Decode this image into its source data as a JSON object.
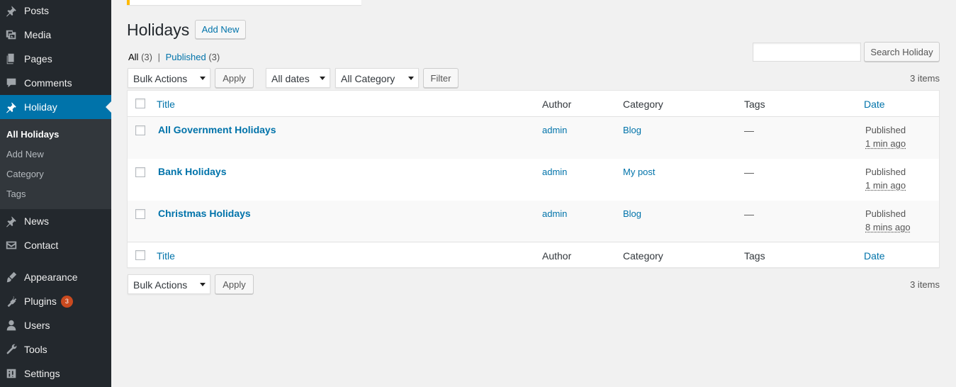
{
  "sidebar": {
    "items": [
      {
        "label": "Posts",
        "icon": "pin-icon"
      },
      {
        "label": "Media",
        "icon": "media-icon"
      },
      {
        "label": "Pages",
        "icon": "pages-icon"
      },
      {
        "label": "Comments",
        "icon": "comment-icon"
      },
      {
        "label": "Holiday",
        "icon": "pin-icon",
        "active": true
      },
      {
        "label": "News",
        "icon": "pin-icon"
      },
      {
        "label": "Contact",
        "icon": "mail-icon"
      },
      {
        "label": "Appearance",
        "icon": "brush-icon"
      },
      {
        "label": "Plugins",
        "icon": "plugin-icon",
        "badge": "3"
      },
      {
        "label": "Users",
        "icon": "user-icon"
      },
      {
        "label": "Tools",
        "icon": "wrench-icon"
      },
      {
        "label": "Settings",
        "icon": "settings-icon"
      }
    ],
    "submenu": [
      "All Holidays",
      "Add New",
      "Category",
      "Tags"
    ],
    "active_color": "#0073aa",
    "background": "#23282d",
    "badge_color": "#ca4a1f"
  },
  "header": {
    "title": "Holidays",
    "add_new": "Add New"
  },
  "views": {
    "all_label": "All",
    "all_count": "(3)",
    "separator": "|",
    "published_label": "Published",
    "published_count": "(3)"
  },
  "search": {
    "placeholder": "",
    "button": "Search Holiday"
  },
  "filters": {
    "bulk_actions": "Bulk Actions",
    "apply": "Apply",
    "dates": "All dates",
    "category": "All Category",
    "filter": "Filter",
    "items_count": "3 items"
  },
  "table": {
    "columns": [
      "Title",
      "Author",
      "Category",
      "Tags",
      "Date"
    ],
    "rows": [
      {
        "title": "All Government Holidays",
        "author": "admin",
        "category": "Blog",
        "tags": "—",
        "status": "Published",
        "ago": "1 min ago"
      },
      {
        "title": "Bank Holidays",
        "author": "admin",
        "category": "My post",
        "tags": "—",
        "status": "Published",
        "ago": "1 min ago"
      },
      {
        "title": "Christmas Holidays",
        "author": "admin",
        "category": "Blog",
        "tags": "—",
        "status": "Published",
        "ago": "8 mins ago"
      }
    ]
  },
  "bottom": {
    "bulk_actions": "Bulk Actions",
    "apply": "Apply",
    "items_count": "3 items"
  }
}
